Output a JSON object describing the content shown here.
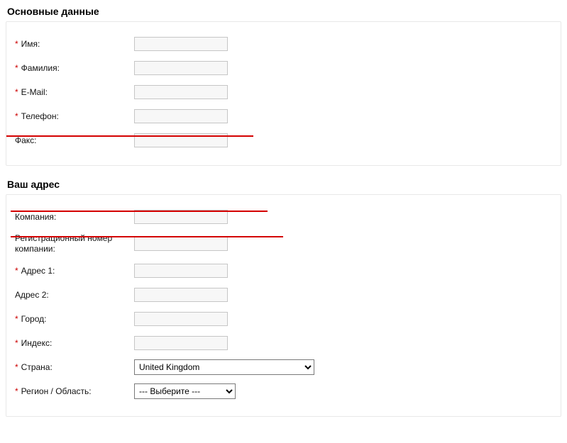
{
  "section1": {
    "title": "Основные данные",
    "fields": {
      "name": {
        "required": true,
        "label": "Имя:"
      },
      "surname": {
        "required": true,
        "label": "Фамилия:"
      },
      "email": {
        "required": true,
        "label": "E-Mail:"
      },
      "phone": {
        "required": true,
        "label": "Телефон:"
      },
      "fax": {
        "required": false,
        "label": "Факс:"
      }
    }
  },
  "section2": {
    "title": "Ваш адрес",
    "fields": {
      "company": {
        "required": false,
        "label": "Компания:"
      },
      "regnum": {
        "required": false,
        "label": "Регистрационный номер компании:"
      },
      "address1": {
        "required": true,
        "label": "Адрес 1:"
      },
      "address2": {
        "required": false,
        "label": "Адрес 2:"
      },
      "city": {
        "required": true,
        "label": "Город:"
      },
      "postcode": {
        "required": true,
        "label": "Индекс:"
      },
      "country": {
        "required": true,
        "label": "Страна:",
        "selected": "United Kingdom"
      },
      "region": {
        "required": true,
        "label": "Регион / Область:",
        "selected": "--- Выберите ---"
      }
    }
  }
}
